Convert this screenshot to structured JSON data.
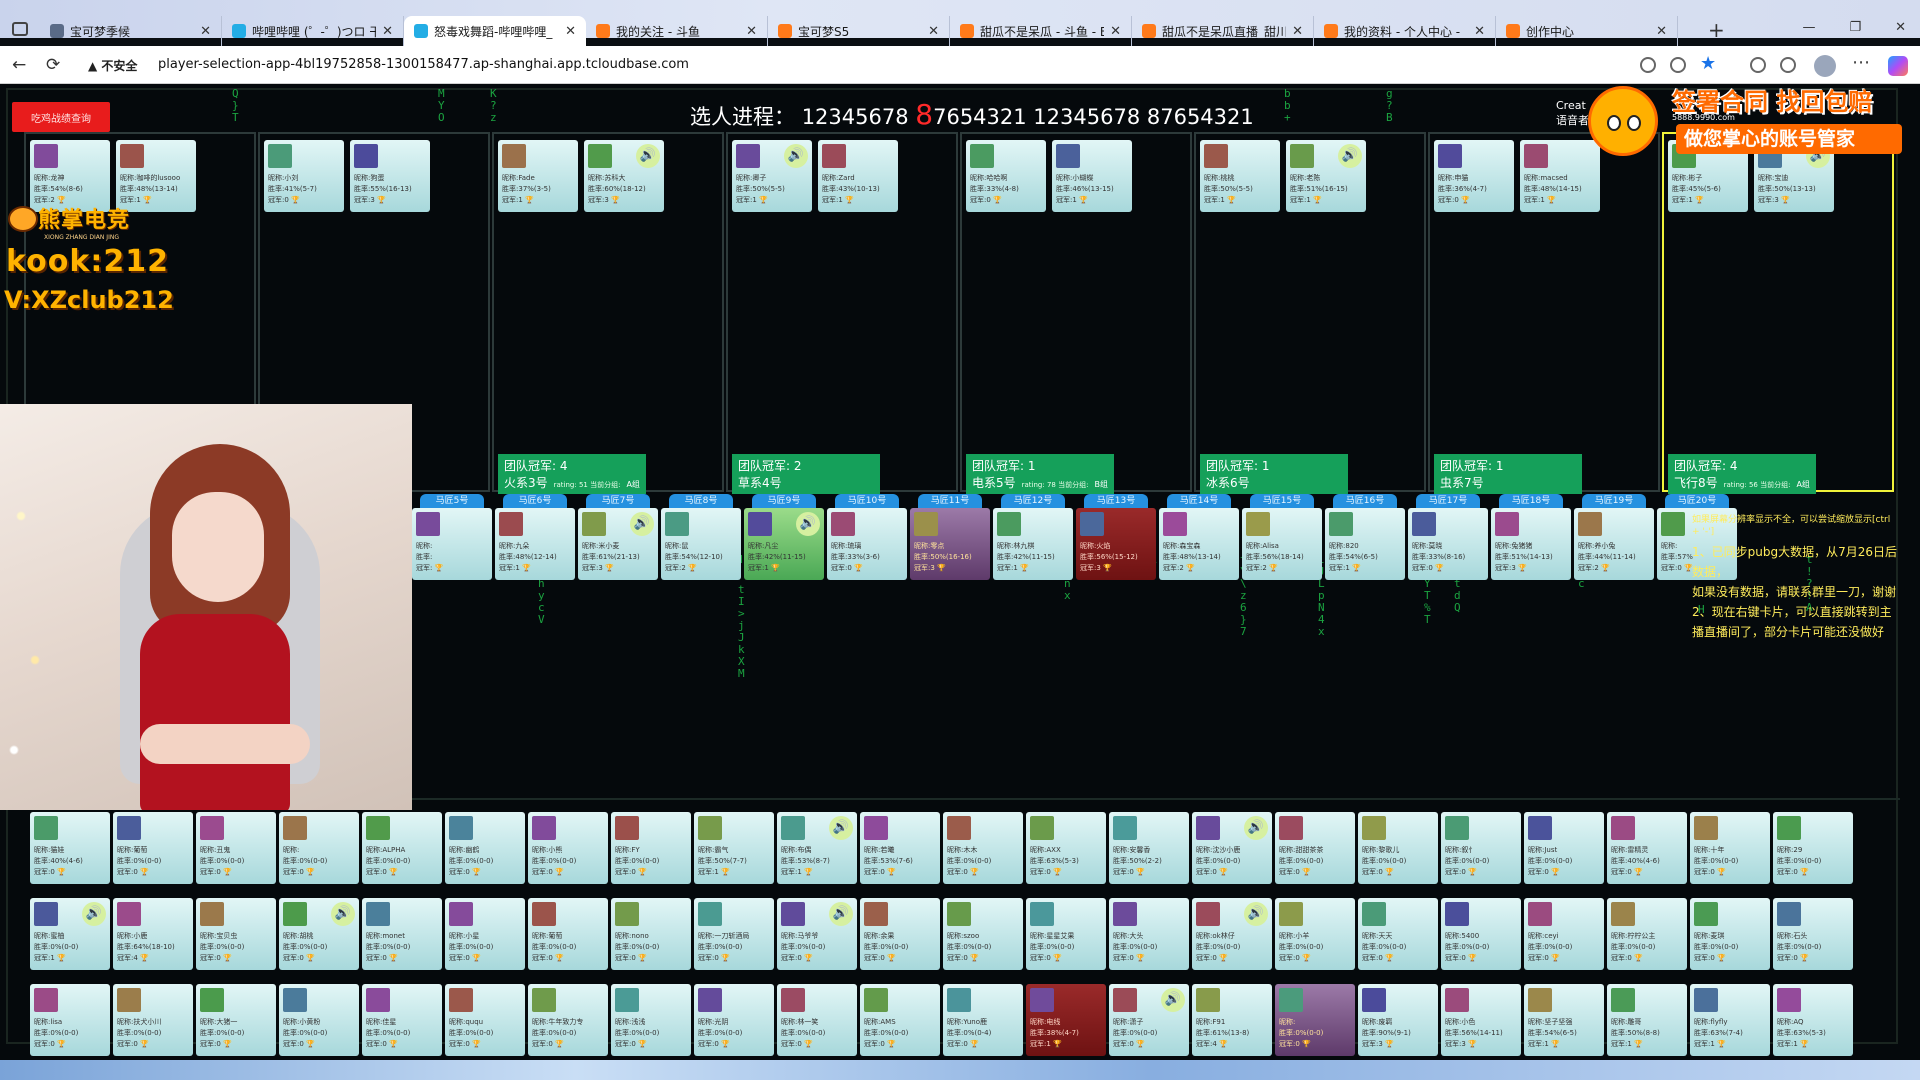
{
  "browser": {
    "tabs": [
      {
        "title": "宝可梦季候",
        "icon": "globe-icon"
      },
      {
        "title": "哔哩哔哩 (゜-゜)つロ 干",
        "icon": "bilibili-icon"
      },
      {
        "title": "怒毒戏舞蹈-哔哩哔哩_",
        "icon": "bilibili-icon"
      },
      {
        "title": "我的关注 - 斗鱼",
        "icon": "douyu-icon"
      },
      {
        "title": "宝可梦S5",
        "icon": "douyu-icon"
      },
      {
        "title": "甜瓜不是呆瓜 - 斗鱼 - E",
        "icon": "douyu-icon"
      },
      {
        "title": "甜瓜不是呆瓜直播_甜川",
        "icon": "douyu-icon"
      },
      {
        "title": "我的资料 - 个人中心 - ",
        "icon": "douyu-icon"
      },
      {
        "title": "创作中心",
        "icon": "douyu-icon"
      }
    ],
    "active_tab": 2,
    "security_label": "不安全",
    "url": "player-selection-app-4bl19752858-1300158477.ap-shanghai.app.tcloudbase.com"
  },
  "header": {
    "query_button": "吃鸡战绩查询",
    "progress_label": "选人进程：",
    "progress_a": "12345678",
    "progress_current": "8",
    "progress_b": "7654321 12345678 87654321",
    "create_note_1": "Creat",
    "create_note_2": "语音者"
  },
  "teams": [
    {
      "cards": [
        {
          "name": "龙神",
          "rate": "54%(8-6)",
          "champ": "2"
        },
        {
          "name": "咖啡的lusooo",
          "rate": "48%(13-14)",
          "champ": "1"
        }
      ]
    },
    {
      "cards": [
        {
          "name": "小刘",
          "rate": "41%(5-7)",
          "champ": "0"
        },
        {
          "name": "狗蛋",
          "rate": "55%(16-13)",
          "champ": "3"
        }
      ]
    },
    {
      "badge": "团队冠军: 4",
      "team": "火系3号",
      "score": "rating: 51 当前分组:",
      "group": "A组",
      "cards": [
        {
          "name": "Fade",
          "rate": "37%(3-5)",
          "champ": "1"
        },
        {
          "name": "苏科大",
          "rate": "60%(18-12)",
          "champ": "3",
          "speaking": true
        }
      ]
    },
    {
      "badge": "团队冠军: 2",
      "team": "草系4号",
      "cards": [
        {
          "name": "卿子",
          "rate": "50%(5-5)",
          "champ": "1",
          "speaking": true
        },
        {
          "name": "Zard",
          "rate": "43%(10-13)",
          "champ": "1"
        }
      ]
    },
    {
      "badge": "团队冠军: 1",
      "team": "电系5号",
      "score": "rating: 78 当前分组:",
      "group": "B组",
      "cards": [
        {
          "name": "哈哈啊",
          "rate": "33%(4-8)",
          "champ": "0"
        },
        {
          "name": "小蝴蝶",
          "rate": "46%(13-15)",
          "champ": "1"
        }
      ]
    },
    {
      "badge": "团队冠军: 1",
      "team": "冰系6号",
      "cards": [
        {
          "name": "桃桃",
          "rate": "50%(5-5)",
          "champ": "1"
        },
        {
          "name": "老陈",
          "rate": "51%(16-15)",
          "champ": "1",
          "speaking": true
        }
      ]
    },
    {
      "badge": "团队冠军: 1",
      "team": "虫系7号",
      "cards": [
        {
          "name": "申猫",
          "rate": "36%(4-7)",
          "champ": "0"
        },
        {
          "name": "macsed",
          "rate": "48%(14-15)",
          "champ": "1"
        }
      ]
    },
    {
      "badge": "团队冠军: 4",
      "team": "飞行8号",
      "score": "rating: 56 当前分组:",
      "group": "A组",
      "selected": true,
      "cards": [
        {
          "name": "彬子",
          "rate": "45%(5-6)",
          "champ": "1"
        },
        {
          "name": "宝迪",
          "rate": "50%(13-13)",
          "champ": "3",
          "speaking": true
        }
      ]
    }
  ],
  "horses": {
    "tabs": [
      "马匠5号",
      "马匠6号",
      "马匠7号",
      "马匠8号",
      "马匠9号",
      "马匠10号",
      "马匠11号",
      "马匠12号",
      "马匠13号",
      "马匠14号",
      "马匠15号",
      "马匠16号",
      "马匠17号",
      "马匠18号",
      "马匠19号",
      "马匠20号"
    ],
    "cards": [
      {
        "name": "",
        "rate": "",
        "champ": "",
        "style": "plain"
      },
      {
        "name": "九朵",
        "rate": "48%(12-14)",
        "champ": "1"
      },
      {
        "name": "米小麦",
        "rate": "61%(21-13)",
        "champ": "3",
        "speaking": true
      },
      {
        "name": "鼠",
        "rate": "54%(12-10)",
        "champ": "2"
      },
      {
        "name": "凡尘",
        "rate": "42%(11-15)",
        "champ": "1",
        "style": "green",
        "speaking": true
      },
      {
        "name": "琉璃",
        "rate": "33%(3-6)",
        "champ": "0"
      },
      {
        "name": "零点",
        "rate": "50%(16-16)",
        "champ": "3",
        "style": "purple"
      },
      {
        "name": "林九棋",
        "rate": "42%(11-15)",
        "champ": "1"
      },
      {
        "name": "火焰",
        "rate": "56%(15-12)",
        "champ": "3",
        "style": "red"
      },
      {
        "name": "森宝森",
        "rate": "48%(13-14)",
        "champ": "2"
      },
      {
        "name": "Alisa",
        "rate": "56%(18-14)",
        "champ": "2"
      },
      {
        "name": "820",
        "rate": "54%(6-5)",
        "champ": "1"
      },
      {
        "name": "莫晓",
        "rate": "33%(8-16)",
        "champ": "0"
      },
      {
        "name": "兔猪猪",
        "rate": "51%(14-13)",
        "champ": "3"
      },
      {
        "name": "养小兔",
        "rate": "44%(11-14)",
        "champ": "2"
      },
      {
        "name": "",
        "rate": "57%",
        "champ": "0"
      }
    ]
  },
  "notice": {
    "small": "如果屏幕分辨率显示不全，可以尝试缩放显示[ctrl + '-']",
    "line1": "1、已同步pubg大数据，从7月26日后数据，",
    "line2": "如果没有数据，请联系群里一刀，谢谢",
    "line3": "2、现在右键卡片，可以直接跳转到主播直播间了，部分卡片可能还没做好"
  },
  "pool": {
    "rows": [
      [
        {
          "name": "猫娃",
          "rate": "40%(4-6)",
          "champ": "0"
        },
        {
          "name": "葡萄",
          "rate": "0%(0-0)",
          "champ": "0"
        },
        {
          "name": "丑鬼",
          "rate": "0%(0-0)",
          "champ": "0"
        },
        {
          "name": "",
          "rate": "0%(0-0)",
          "champ": "0"
        },
        {
          "name": "ALPHA",
          "rate": "0%(0-0)",
          "champ": "0"
        },
        {
          "name": "幽鹤",
          "rate": "0%(0-0)",
          "champ": "0"
        },
        {
          "name": "小熊",
          "rate": "0%(0-0)",
          "champ": "0"
        },
        {
          "name": "FY",
          "rate": "0%(0-0)",
          "champ": "0"
        },
        {
          "name": "霸气",
          "rate": "50%(7-7)",
          "champ": "1"
        },
        {
          "name": "布偶",
          "rate": "53%(8-7)",
          "champ": "1",
          "speaking": true
        },
        {
          "name": "若曦",
          "rate": "53%(7-6)",
          "champ": "0"
        },
        {
          "name": "木木",
          "rate": "0%(0-0)",
          "champ": "0"
        },
        {
          "name": "AXX",
          "rate": "63%(5-3)",
          "champ": "0"
        },
        {
          "name": "安馨香",
          "rate": "50%(2-2)",
          "champ": "0"
        },
        {
          "name": "沈沙小鹿",
          "rate": "0%(0-0)",
          "champ": "0",
          "speaking": true
        },
        {
          "name": "甜甜茶茶",
          "rate": "0%(0-0)",
          "champ": "0"
        },
        {
          "name": "黎歌儿",
          "rate": "0%(0-0)",
          "champ": "0"
        },
        {
          "name": "叙忄",
          "rate": "0%(0-0)",
          "champ": "0"
        },
        {
          "name": "Just",
          "rate": "0%(0-0)",
          "champ": "0"
        },
        {
          "name": "雷精灵",
          "rate": "40%(4-6)",
          "champ": "0"
        },
        {
          "name": "十年",
          "rate": "0%(0-0)",
          "champ": "0"
        },
        {
          "name": "29",
          "rate": "0%(0-0)",
          "champ": "0"
        }
      ],
      [
        {
          "name": "蜜柚",
          "rate": "0%(0-0)",
          "champ": "1",
          "speaking": true
        },
        {
          "name": "小鹿",
          "rate": "64%(18-10)",
          "champ": "4"
        },
        {
          "name": "宝贝虫",
          "rate": "0%(0-0)",
          "champ": "0"
        },
        {
          "name": "胡桃",
          "rate": "0%(0-0)",
          "champ": "0",
          "speaking": true
        },
        {
          "name": "monet",
          "rate": "0%(0-0)",
          "champ": "0"
        },
        {
          "name": "小星",
          "rate": "0%(0-0)",
          "champ": "0"
        },
        {
          "name": "葡萄",
          "rate": "0%(0-0)",
          "champ": "0"
        },
        {
          "name": "nono",
          "rate": "0%(0-0)",
          "champ": "0"
        },
        {
          "name": "一刀斩酒局",
          "rate": "0%(0-0)",
          "champ": "0"
        },
        {
          "name": "马爷爷",
          "rate": "0%(0-0)",
          "champ": "0",
          "speaking": true
        },
        {
          "name": "余果",
          "rate": "0%(0-0)",
          "champ": "0"
        },
        {
          "name": "szoo",
          "rate": "0%(0-0)",
          "champ": "0"
        },
        {
          "name": "星星艾果",
          "rate": "0%(0-0)",
          "champ": "0"
        },
        {
          "name": "大头",
          "rate": "0%(0-0)",
          "champ": "0"
        },
        {
          "name": "ok林仔",
          "rate": "0%(0-0)",
          "champ": "0",
          "speaking": true
        },
        {
          "name": "小羊",
          "rate": "0%(0-0)",
          "champ": "0"
        },
        {
          "name": "天天",
          "rate": "0%(0-0)",
          "champ": "0"
        },
        {
          "name": "5400",
          "rate": "0%(0-0)",
          "champ": "0"
        },
        {
          "name": "ceyi",
          "rate": "0%(0-0)",
          "champ": "0"
        },
        {
          "name": "柠柠公主",
          "rate": "0%(0-0)",
          "champ": "0"
        },
        {
          "name": "麦琪",
          "rate": "0%(0-0)",
          "champ": "0"
        },
        {
          "name": "石头",
          "rate": "0%(0-0)",
          "champ": "0"
        }
      ],
      [
        {
          "name": "lisa",
          "rate": "0%(0-0)",
          "champ": "0"
        },
        {
          "name": "扶犬小川",
          "rate": "0%(0-0)",
          "champ": "0"
        },
        {
          "name": "大猪一",
          "rate": "0%(0-0)",
          "champ": "0"
        },
        {
          "name": "小黄粉",
          "rate": "0%(0-0)",
          "champ": "0"
        },
        {
          "name": "佳星",
          "rate": "0%(0-0)",
          "champ": "0"
        },
        {
          "name": "ququ",
          "rate": "0%(0-0)",
          "champ": "0"
        },
        {
          "name": "牛年致力专",
          "rate": "0%(0-0)",
          "champ": "0"
        },
        {
          "name": "浅浅",
          "rate": "0%(0-0)",
          "champ": "0"
        },
        {
          "name": "光阴",
          "rate": "0%(0-0)",
          "champ": "0"
        },
        {
          "name": "林一笑",
          "rate": "0%(0-0)",
          "champ": "0"
        },
        {
          "name": "AMS",
          "rate": "0%(0-0)",
          "champ": "0"
        },
        {
          "name": "Yuno鹿",
          "rate": "0%(0-4)",
          "champ": "0"
        },
        {
          "name": "电线",
          "rate": "38%(4-7)",
          "champ": "1",
          "style": "red"
        },
        {
          "name": "潇子",
          "rate": "0%(0-0)",
          "champ": "0",
          "speaking": true
        },
        {
          "name": "F91",
          "rate": "61%(13-8)",
          "champ": "4"
        },
        {
          "name": "",
          "rate": "0%(0-0)",
          "champ": "0",
          "style": "purple"
        },
        {
          "name": "废羁",
          "rate": "90%(9-1)",
          "champ": "3"
        },
        {
          "name": "小色",
          "rate": "56%(14-11)",
          "champ": "3"
        },
        {
          "name": "坚子坚强",
          "rate": "54%(6-5)",
          "champ": "1"
        },
        {
          "name": "雕哥",
          "rate": "50%(8-8)",
          "champ": "1"
        },
        {
          "name": "flyfly",
          "rate": "63%(7-4)",
          "champ": "1"
        },
        {
          "name": "AQ",
          "rate": "63%(5-3)",
          "champ": "1"
        }
      ]
    ]
  },
  "overlays": {
    "logo_brand": "熊掌电竞",
    "logo_sub": "XIONG ZHANG DIAN JING",
    "kook": "kook:212",
    "vx": "V:XZclub212",
    "ad_line1": "签署合同 找回包赔",
    "ad_line2": "做您掌心的账号管家",
    "ad_tiny": "5888.9990.com"
  },
  "card_labels": {
    "name": "昵称:",
    "rate": "胜率:",
    "champ": "冠军:"
  },
  "colors": {
    "accent_red": "#e81c1c",
    "team_green": "#15a05a",
    "tab_blue": "#2591e0",
    "notice_yellow": "#ffec5c",
    "rain_green": "#1fbf4a"
  }
}
